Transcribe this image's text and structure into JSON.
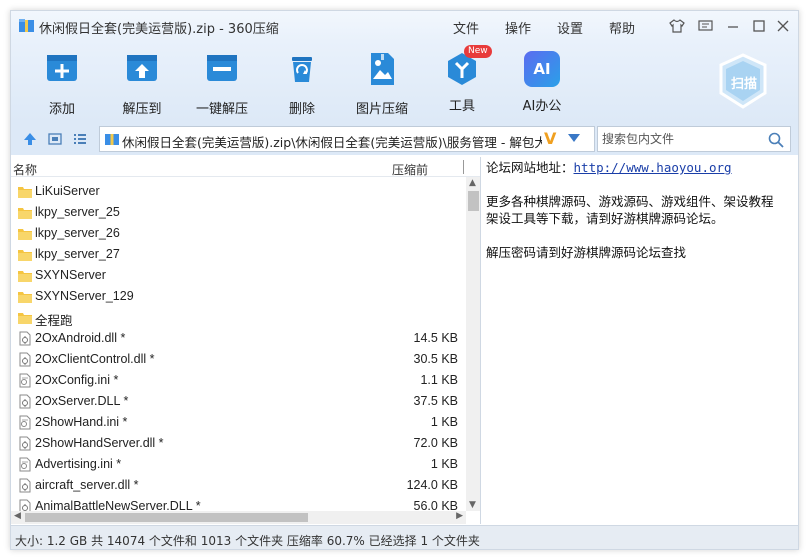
{
  "window": {
    "title": "休闲假日全套(完美运营版).zip - 360压缩"
  },
  "menu": {
    "file": "文件",
    "operate": "操作",
    "settings": "设置",
    "help": "帮助"
  },
  "toolbar": {
    "add": "添加",
    "extract_to": "解压到",
    "one_click_extract": "一键解压",
    "delete": "删除",
    "image_compress": "图片压缩",
    "tools": "工具",
    "tools_badge": "New",
    "ai_office": "AI办公",
    "ai_icon_text": "AI",
    "scan": "扫描"
  },
  "address": {
    "path": "休闲假日全套(完美运营版).zip\\休闲假日全套(完美运营版)\\服务管理 - 解包大小",
    "badge": "V"
  },
  "search": {
    "placeholder": "搜索包内文件"
  },
  "filelist": {
    "col_name": "名称",
    "col_size": "压缩前",
    "rows": [
      {
        "name": "LiKuiServer",
        "size": "",
        "type": "folder"
      },
      {
        "name": "lkpy_server_25",
        "size": "",
        "type": "folder"
      },
      {
        "name": "lkpy_server_26",
        "size": "",
        "type": "folder"
      },
      {
        "name": "lkpy_server_27",
        "size": "",
        "type": "folder"
      },
      {
        "name": "SXYNServer",
        "size": "",
        "type": "folder"
      },
      {
        "name": "SXYNServer_129",
        "size": "",
        "type": "folder"
      },
      {
        "name": "全程跑",
        "size": "",
        "type": "folder"
      },
      {
        "name": "2OxAndroid.dll *",
        "size": "14.5 KB",
        "type": "dll"
      },
      {
        "name": "2OxClientControl.dll *",
        "size": "30.5 KB",
        "type": "dll"
      },
      {
        "name": "2OxConfig.ini *",
        "size": "1.1 KB",
        "type": "ini"
      },
      {
        "name": "2OxServer.DLL *",
        "size": "37.5 KB",
        "type": "dll"
      },
      {
        "name": "2ShowHand.ini *",
        "size": "1 KB",
        "type": "ini"
      },
      {
        "name": "2ShowHandServer.dll *",
        "size": "72.0 KB",
        "type": "dll"
      },
      {
        "name": "Advertising.ini *",
        "size": "1 KB",
        "type": "ini"
      },
      {
        "name": "aircraft_server.dll *",
        "size": "124.0 KB",
        "type": "dll"
      },
      {
        "name": "AnimalBattleNewServer.DLL *",
        "size": "56.0 KB",
        "type": "dll"
      }
    ]
  },
  "comment": {
    "forum_label": "论坛网站地址：",
    "forum_url": "http://www.haoyou.org",
    "line2": "更多各种棋牌源码、游戏源码、游戏组件、架设教程",
    "line3": "架设工具等下载，请到好游棋牌源码论坛。",
    "line4": "解压密码请到好游棋牌源码论坛查找"
  },
  "status": {
    "text": "大小: 1.2 GB 共 14074 个文件和 1013 个文件夹 压缩率 60.7% 已经选择 1 个文件夹"
  },
  "colors": {
    "accent": "#2a8ad8",
    "titlebar": "#eef4fc",
    "toolbar": "#dde9f7"
  }
}
